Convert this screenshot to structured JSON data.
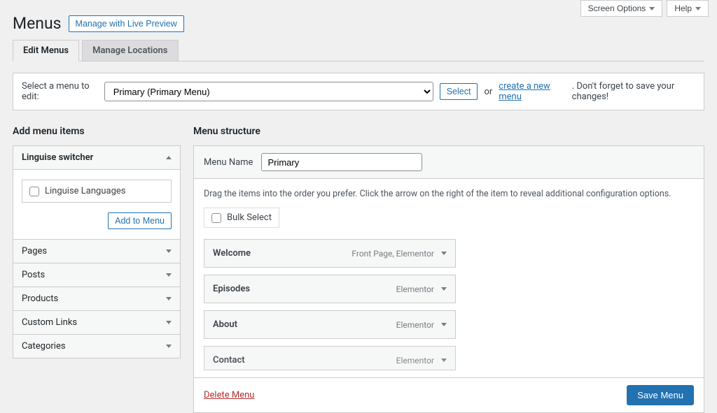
{
  "topbar": {
    "screen_options": "Screen Options",
    "help": "Help"
  },
  "header": {
    "title": "Menus",
    "live_preview": "Manage with Live Preview"
  },
  "tabs": {
    "edit": "Edit Menus",
    "locations": "Manage Locations"
  },
  "select_bar": {
    "label": "Select a menu to edit:",
    "selected": "Primary (Primary Menu)",
    "select_btn": "Select",
    "or": "or",
    "create_link": "create a new menu",
    "suffix": ". Don't forget to save your changes!"
  },
  "left": {
    "heading": "Add menu items",
    "sections": {
      "linguise": "Linguise switcher",
      "linguise_item": "Linguise Languages",
      "add_btn": "Add to Menu",
      "pages": "Pages",
      "posts": "Posts",
      "products": "Products",
      "custom_links": "Custom Links",
      "categories": "Categories"
    }
  },
  "right": {
    "heading": "Menu structure",
    "menu_name_label": "Menu Name",
    "menu_name_value": "Primary",
    "hint": "Drag the items into the order you prefer. Click the arrow on the right of the item to reveal additional configuration options.",
    "bulk": "Bulk Select",
    "items": [
      {
        "title": "Welcome",
        "type": "Front Page, Elementor"
      },
      {
        "title": "Episodes",
        "type": "Elementor"
      },
      {
        "title": "About",
        "type": "Elementor"
      },
      {
        "title": "Contact",
        "type": "Elementor"
      }
    ],
    "delete": "Delete Menu",
    "save": "Save Menu"
  }
}
